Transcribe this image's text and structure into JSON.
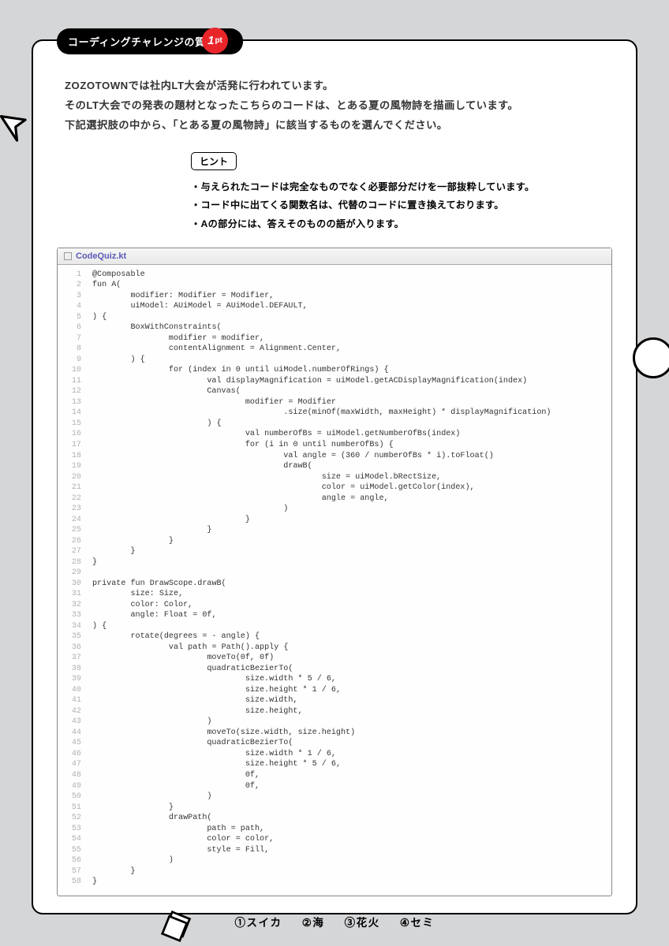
{
  "badge": "コーディングチャレンジの質問",
  "points": {
    "num": "1",
    "unit": "pt"
  },
  "intro": [
    "ZOZOTOWNでは社内LT大会が活発に行われています。",
    "そのLT大会での発表の題材となったこちらのコードは、とある夏の風物詩を描画しています。",
    "下記選択肢の中から、「とある夏の風物詩」に該当するものを選んでください。"
  ],
  "hint_label": "ヒント",
  "hints": [
    "・与えられたコードは完全なものでなく必要部分だけを一部抜粋しています。",
    "・コード中に出てくる関数名は、代替のコードに置き換えております。",
    "・Aの部分には、答えそのものの語が入ります。"
  ],
  "filename": "CodeQuiz.kt",
  "code": [
    "@Composable",
    "<kw>fun</kw> A(",
    "        modifier: <ty>Modifier</ty> <eq>=</eq> <ty>Modifier</ty>,",
    "        uiModel: <ty>AUiModel</ty> <eq>=</eq> <ty>AUiModel.DEFAULT</ty>,",
    ") {",
    "        <fn>BoxWithConstraints</fn>(",
    "                modifier <eq>=</eq> modifier,",
    "                contentAlignment <eq>=</eq> <ty>Alignment.Center</ty>,",
    "        ) {",
    "                <kw>for</kw> (index <kw>in</kw> <num>0</num> until uiModel.numberOfRings) {",
    "                        <kw>val</kw> displayMagnification <eq>=</eq> uiModel.getACDisplayMagnification(index)",
    "                        <fn>Canvas</fn>(",
    "                                modifier <eq>=</eq> <ty>Modifier</ty>",
    "                                        .size(minOf(maxWidth, maxHeight) * displayMagnification)",
    "                        ) {",
    "                                <kw>val</kw> numberOfBs <eq>=</eq> uiModel.getNumberOfBs(index)",
    "                                <kw>for</kw> (i <kw>in</kw> <num>0</num> until numberOfBs) {",
    "                                        <kw>val</kw> angle <eq>=</eq> (<num>360</num> / numberOfBs * i).toFloat()",
    "                                        drawB(",
    "                                                size <eq>=</eq> uiModel.bRectSize,",
    "                                                color <eq>=</eq> uiModel.getColor(index),",
    "                                                angle <eq>=</eq> angle,",
    "                                        )",
    "                                }",
    "                        }",
    "                }",
    "        }",
    "}",
    "",
    "<kw>private fun</kw> DrawScope.drawB(",
    "        size: <ty>Size</ty>,",
    "        color: <ty>Color</ty>,",
    "        angle: <ty>Float</ty> <eq>=</eq> 0f,",
    ") {",
    "        rotate(degrees <eq>=</eq> - angle) {",
    "                <kw>val</kw> path <eq>=</eq> <ty>Path</ty>().<ty>apply</ty> {",
    "                        moveTo(<num>0f</num>, <num>0f</num>)",
    "                        quadraticBezierTo(",
    "                                size.width * <num>5</num> / <num>6</num>,",
    "                                size.height * <num>1</num> / <num>6</num>,",
    "                                size.width,",
    "                                size.height,",
    "                        )",
    "                        moveTo(size.width, size.height)",
    "                        quadraticBezierTo(",
    "                                size.width * <num>1</num> / <num>6</num>,",
    "                                size.height * <num>5</num> / <num>6</num>,",
    "                                <num>0f</num>,",
    "                                <num>0f</num>,",
    "                        )",
    "                }",
    "                drawPath(",
    "                        path <eq>=</eq> path,",
    "                        color <eq>=</eq> color,",
    "                        style <eq>=</eq> <ty>Fill</ty>,",
    "                )",
    "        }",
    "}"
  ],
  "answers": [
    "①スイカ",
    "②海",
    "③花火",
    "④セミ"
  ]
}
